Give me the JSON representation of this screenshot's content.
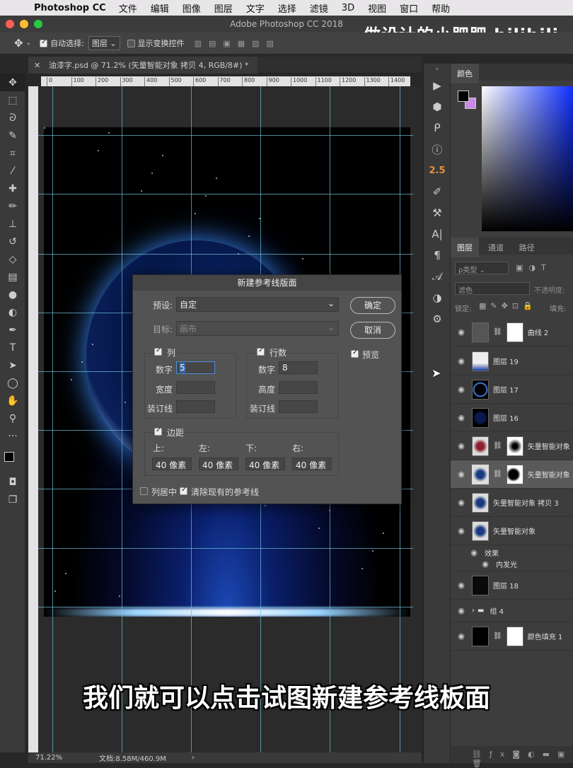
{
  "menubar": {
    "app": "Photoshop CC",
    "items": [
      "文件",
      "编辑",
      "图像",
      "图层",
      "文字",
      "选择",
      "滤镜",
      "3D",
      "视图",
      "窗口",
      "帮助"
    ]
  },
  "window": {
    "title": "Adobe Photoshop CC 2018",
    "watermark": "做设计的小肥肥 bilibili"
  },
  "options": {
    "auto_select_label": "自动选择:",
    "auto_select_value": "图层",
    "show_transform_label": "显示变换控件"
  },
  "document": {
    "tab_label": "油漆字.psd @ 71.2% (矢量智能对象 拷贝 4, RGB/8#) *"
  },
  "ruler": {
    "top_ticks": [
      "0",
      "100",
      "200",
      "300",
      "400",
      "500",
      "600",
      "700",
      "800",
      "900",
      "1000",
      "1100",
      "1200",
      "1300",
      "1400"
    ]
  },
  "status": {
    "zoom": "71.22%",
    "doc_size": "文档:8.58M/460.9M"
  },
  "panelstrip": {
    "value_label": "2.5"
  },
  "right_panel": {
    "color_tab": "颜色",
    "tabs": [
      "图层",
      "通道",
      "路径"
    ],
    "filter_label": "ρ类型",
    "blend_mode": "滤色",
    "opacity_label": "不透明度:",
    "lock_label": "锁定:",
    "fill_label": "填充:",
    "layers": [
      {
        "name": "曲线 2"
      },
      {
        "name": "图层 19"
      },
      {
        "name": "图层 17"
      },
      {
        "name": "图层 16"
      },
      {
        "name": "矢量智能对象"
      },
      {
        "name": "矢量智能对象"
      },
      {
        "name": "矢量智能对象 拷贝 3"
      },
      {
        "name": "矢量智能对象"
      },
      {
        "name": "效果"
      },
      {
        "name": "内发光"
      },
      {
        "name": "图层 18"
      },
      {
        "name": "组 4"
      },
      {
        "name": "颜色填充 1"
      }
    ]
  },
  "dialog": {
    "title": "新建参考线版面",
    "preset_label": "预设:",
    "preset_value": "自定",
    "target_label": "目标:",
    "target_value": "画布",
    "ok_label": "确定",
    "cancel_label": "取消",
    "preview_label": "预览",
    "columns_label": "列",
    "rows_label": "行数",
    "number_label": "数字",
    "width_label": "宽度",
    "height_label": "高度",
    "gutter_label": "装订线",
    "columns_number": "5",
    "rows_number": "8",
    "margin_label": "边距",
    "top_label": "上:",
    "left_label": "左:",
    "bottom_label": "下:",
    "right_label": "右:",
    "margin_top": "40 像素",
    "margin_left": "40 像素",
    "margin_bottom": "40 像素",
    "margin_right": "40 像素",
    "center_columns_label": "列居中",
    "clear_guides_label": "清除现有的参考线"
  },
  "caption": {
    "text": "我们就可以点击试图新建参考线板面"
  }
}
